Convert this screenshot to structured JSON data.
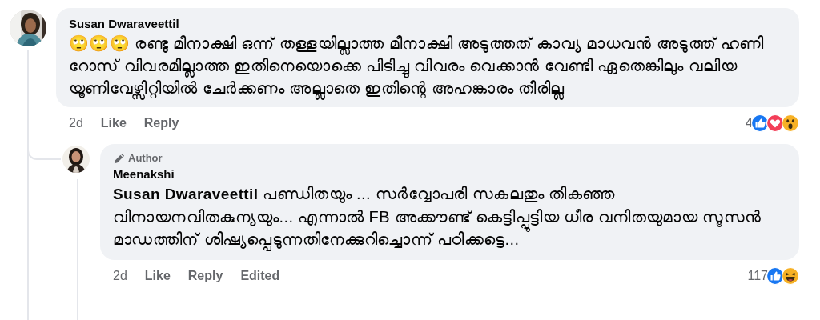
{
  "comment": {
    "author": "Susan Dwaraveettil",
    "text": "🙄🙄🙄 രണ്ടു മീനാക്ഷി ഒന്ന് തള്ളയില്ലാത്ത മീനാക്ഷി അടുത്തത് കാവ്യ മാധവൻ അടുത്ത് ഹണി റോസ് വിവരമില്ലാത്ത ഇതിനെയൊക്കെ പിടിച്ചു വിവരം വെക്കാൻ വേണ്ടി ഏതെങ്കിലും വലിയ യൂണിവേഴ്സിറ്റിയിൽ ചേർക്കണം അല്ലാതെ ഇതിന്റെ അഹങ്കാരം തീരില്ല",
    "actions": [
      {
        "label": "2d",
        "kind": "time"
      },
      {
        "label": "Like",
        "kind": "link"
      },
      {
        "label": "Reply",
        "kind": "link"
      }
    ],
    "reaction_count": "4",
    "reactions": [
      {
        "kind": "like"
      },
      {
        "kind": "love"
      },
      {
        "kind": "wow"
      }
    ]
  },
  "reply": {
    "badge": "Author",
    "author": "Meenakshi",
    "text": "**Susan Dwaraveettil** പണ്ഡിതയും ... സർവ്വോപരി സകലതും തികഞ്ഞ വിനായനവിതകുന്യയും... എന്നാൽ FB അക്കൗണ്ട് കെട്ടിപ്പൂട്ടിയ ധീര വനിതയുമായ സൂസൻ മാഡത്തിന് ശിഷ്യപ്പെടുന്നതിനേക്കുറിച്ചൊന്ന് പഠിക്കട്ടെ...",
    "actions": [
      {
        "label": "2d",
        "kind": "time"
      },
      {
        "label": "Like",
        "kind": "link"
      },
      {
        "label": "Reply",
        "kind": "link"
      },
      {
        "label": "Edited",
        "kind": "link"
      }
    ],
    "reaction_count": "117",
    "reactions": [
      {
        "kind": "like"
      },
      {
        "kind": "haha"
      }
    ]
  }
}
